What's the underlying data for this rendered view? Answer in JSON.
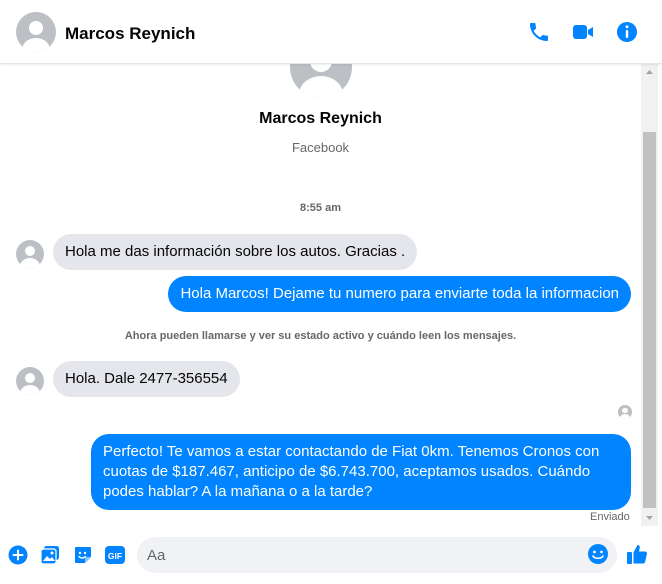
{
  "header": {
    "contact_name": "Marcos Reynich",
    "icons": [
      "phone-icon",
      "video-camera-icon",
      "info-icon"
    ]
  },
  "profile": {
    "name": "Marcos Reynich",
    "subtitle": "Facebook"
  },
  "conversation": {
    "timestamp": "8:55 am",
    "notice": "Ahora pueden llamarse y ver su estado activo y cuándo leen los mensajes.",
    "messages": [
      {
        "direction": "incoming",
        "text": "Hola me das información sobre los autos. Gracias ."
      },
      {
        "direction": "outgoing",
        "text": "Hola Marcos! Dejame tu numero para enviarte toda la informacion"
      },
      {
        "direction": "incoming",
        "text": "Hola. Dale 2477-356554"
      },
      {
        "direction": "outgoing",
        "text": "Perfecto! Te vamos a estar contactando de Fiat 0km. Tenemos Cronos con cuotas de $187.467, anticipo de $6.743.700, aceptamos usados. Cuándo podes hablar? A la mañana o a la tarde?"
      }
    ],
    "status": "Enviado"
  },
  "composer": {
    "placeholder": "Aa",
    "icons": [
      "plus-icon",
      "photo-icon",
      "sticker-icon",
      "gif-icon",
      "emoji-icon",
      "thumbs-up-icon"
    ]
  },
  "colors": {
    "accent": "#0084ff",
    "incoming_bubble": "#e4e6eb",
    "muted_text": "#65676b"
  }
}
